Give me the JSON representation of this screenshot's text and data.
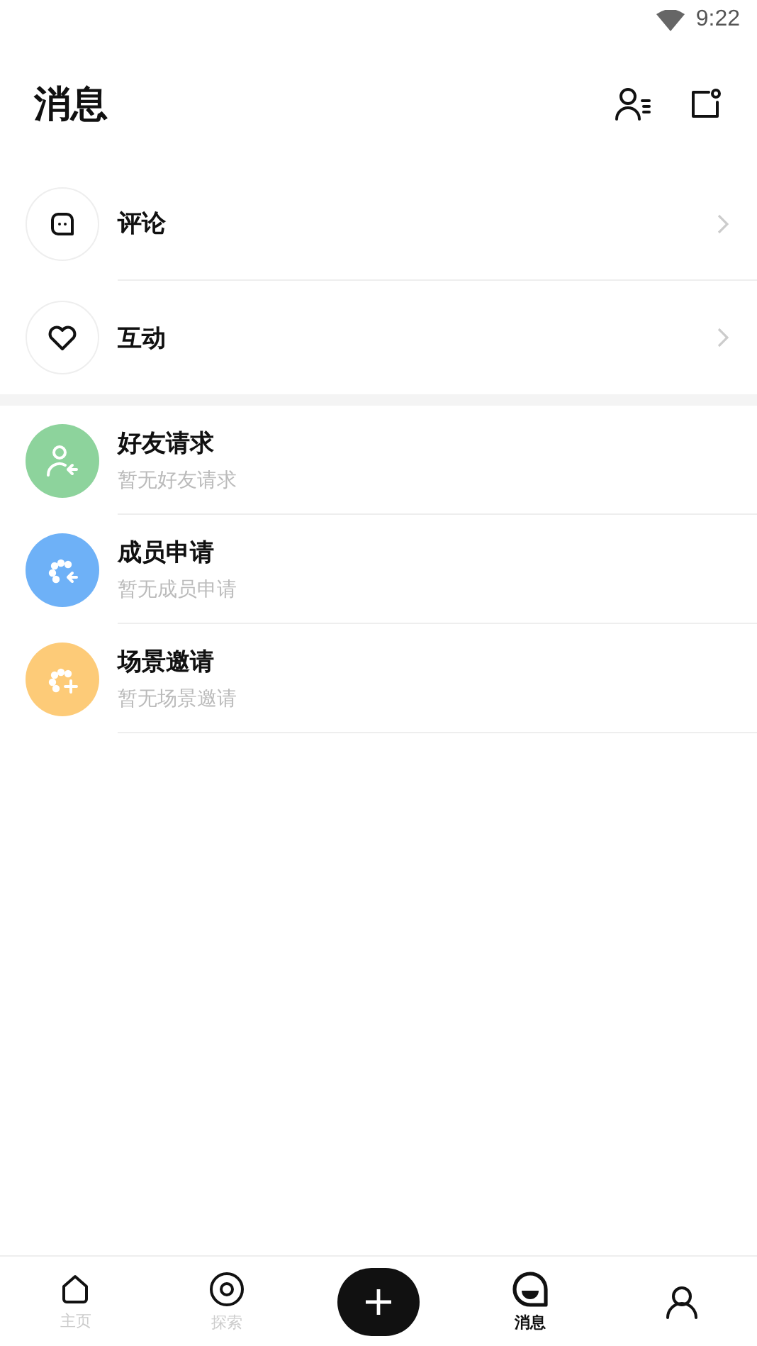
{
  "status_bar": {
    "time": "9:22"
  },
  "header": {
    "title": "消息"
  },
  "entries": [
    {
      "kind": "comment",
      "label": "评论"
    },
    {
      "kind": "interaction",
      "label": "互动"
    }
  ],
  "requests": [
    {
      "kind": "friend",
      "title": "好友请求",
      "subtitle": "暂无好友请求",
      "color": "#8dd39c"
    },
    {
      "kind": "member",
      "title": "成员申请",
      "subtitle": "暂无成员申请",
      "color": "#6eb1f7"
    },
    {
      "kind": "scene",
      "title": "场景邀请",
      "subtitle": "暂无场景邀请",
      "color": "#fdcb78"
    }
  ],
  "nav": [
    {
      "kind": "home",
      "label": "主页",
      "selected": false
    },
    {
      "kind": "explore",
      "label": "探索",
      "selected": false
    },
    {
      "kind": "add"
    },
    {
      "kind": "messages",
      "label": "消息",
      "selected": true
    },
    {
      "kind": "profile",
      "selected": false
    }
  ]
}
